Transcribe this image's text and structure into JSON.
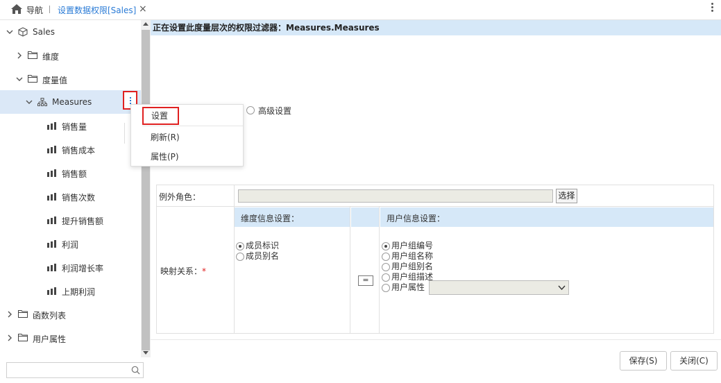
{
  "tabs": {
    "nav_label": "导航",
    "active_label": "设置数据权限[Sales]",
    "close_glyph": "×"
  },
  "tree": {
    "root": "Sales",
    "dimensions": "维度",
    "measures_folder": "度量值",
    "measures_node": "Measures",
    "measure_items": [
      "销售量",
      "销售成本",
      "销售额",
      "销售次数",
      "提升销售额",
      "利润",
      "利润增长率",
      "上期利润"
    ],
    "functions": "函数列表",
    "user_attrs": "用户属性"
  },
  "context_menu": {
    "items": [
      "设置",
      "刷新(R)",
      "属性(P)"
    ]
  },
  "main": {
    "header": "正在设置此度量层次的权限过滤器：Measures.Measures",
    "advanced_label": "高级设置",
    "exception_role_label": "例外角色：",
    "select_button": "选择",
    "mapping_label": "映射关系：",
    "required_mark": "*",
    "dim_info_header": "维度信息设置：",
    "user_info_header": "用户信息设置：",
    "dim_options": [
      "成员标识",
      "成员别名"
    ],
    "user_options": [
      "用户组编号",
      "用户组名称",
      "用户组别名",
      "用户组描述",
      "用户属性"
    ],
    "equals": "="
  },
  "footer": {
    "save": "保存(S)",
    "close": "关闭(C)"
  },
  "colors": {
    "accent": "#2a7bd6",
    "header_bg": "#d6e8f8",
    "selected_bg": "#dbe8f7",
    "highlight_border": "#e02020"
  }
}
